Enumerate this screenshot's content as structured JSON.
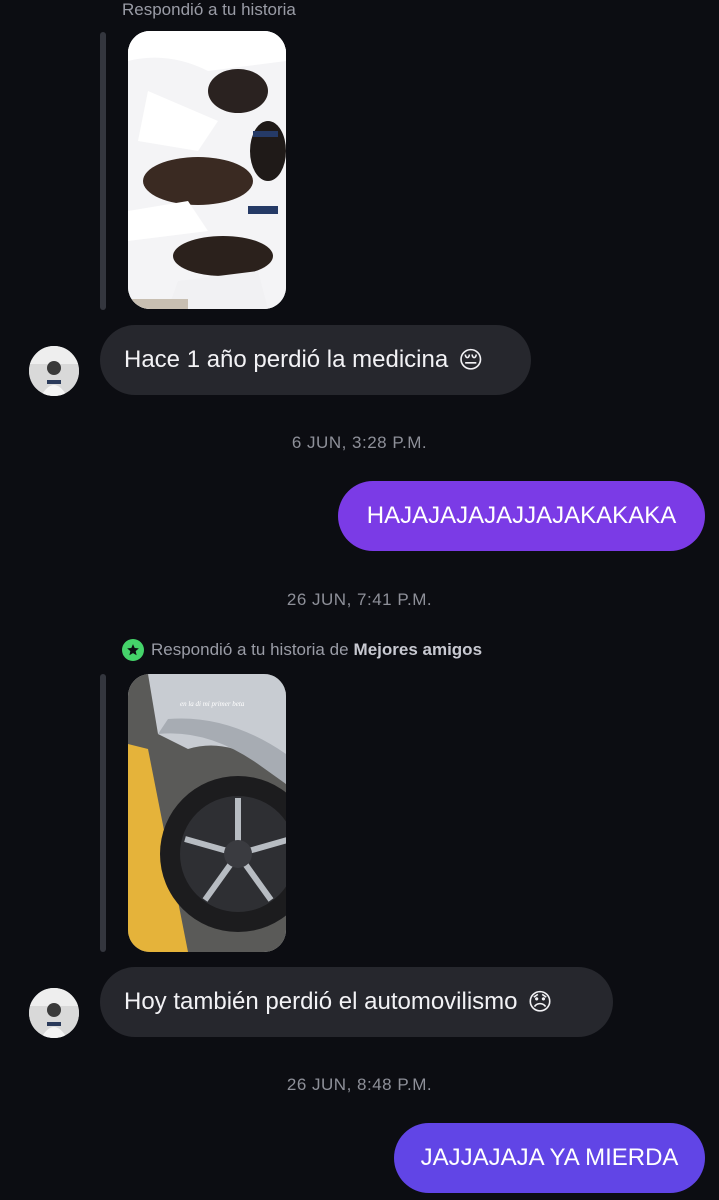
{
  "messages": {
    "m1": {
      "reply_label": "Respondió a tu historia",
      "text": "Hace 1 año perdió la medicina",
      "emoji": "😔"
    },
    "ts1": "6 JUN, 3:28 P.M.",
    "m2": {
      "text": "HAJAJAJAJAJJAJAKAKAKA"
    },
    "ts2": "26 JUN, 7:41 P.M.",
    "m3": {
      "reply_prefix": "Respondió a tu historia de",
      "reply_bold": "Mejores amigos",
      "story_caption": "en la di mi primer beta",
      "text": "Hoy también perdió el automovilismo",
      "emoji": "😞"
    },
    "ts3": "26 JUN, 8:48 P.M.",
    "m4": {
      "text": "JAJJAJAJA YA MIERDA"
    }
  },
  "colors": {
    "background": "#0c0d12",
    "incoming_bubble": "#26272d",
    "outgoing_bubble_1": "#7b3be6",
    "outgoing_bubble_2": "#6145e6",
    "best_friends_star": "#45d36a"
  }
}
